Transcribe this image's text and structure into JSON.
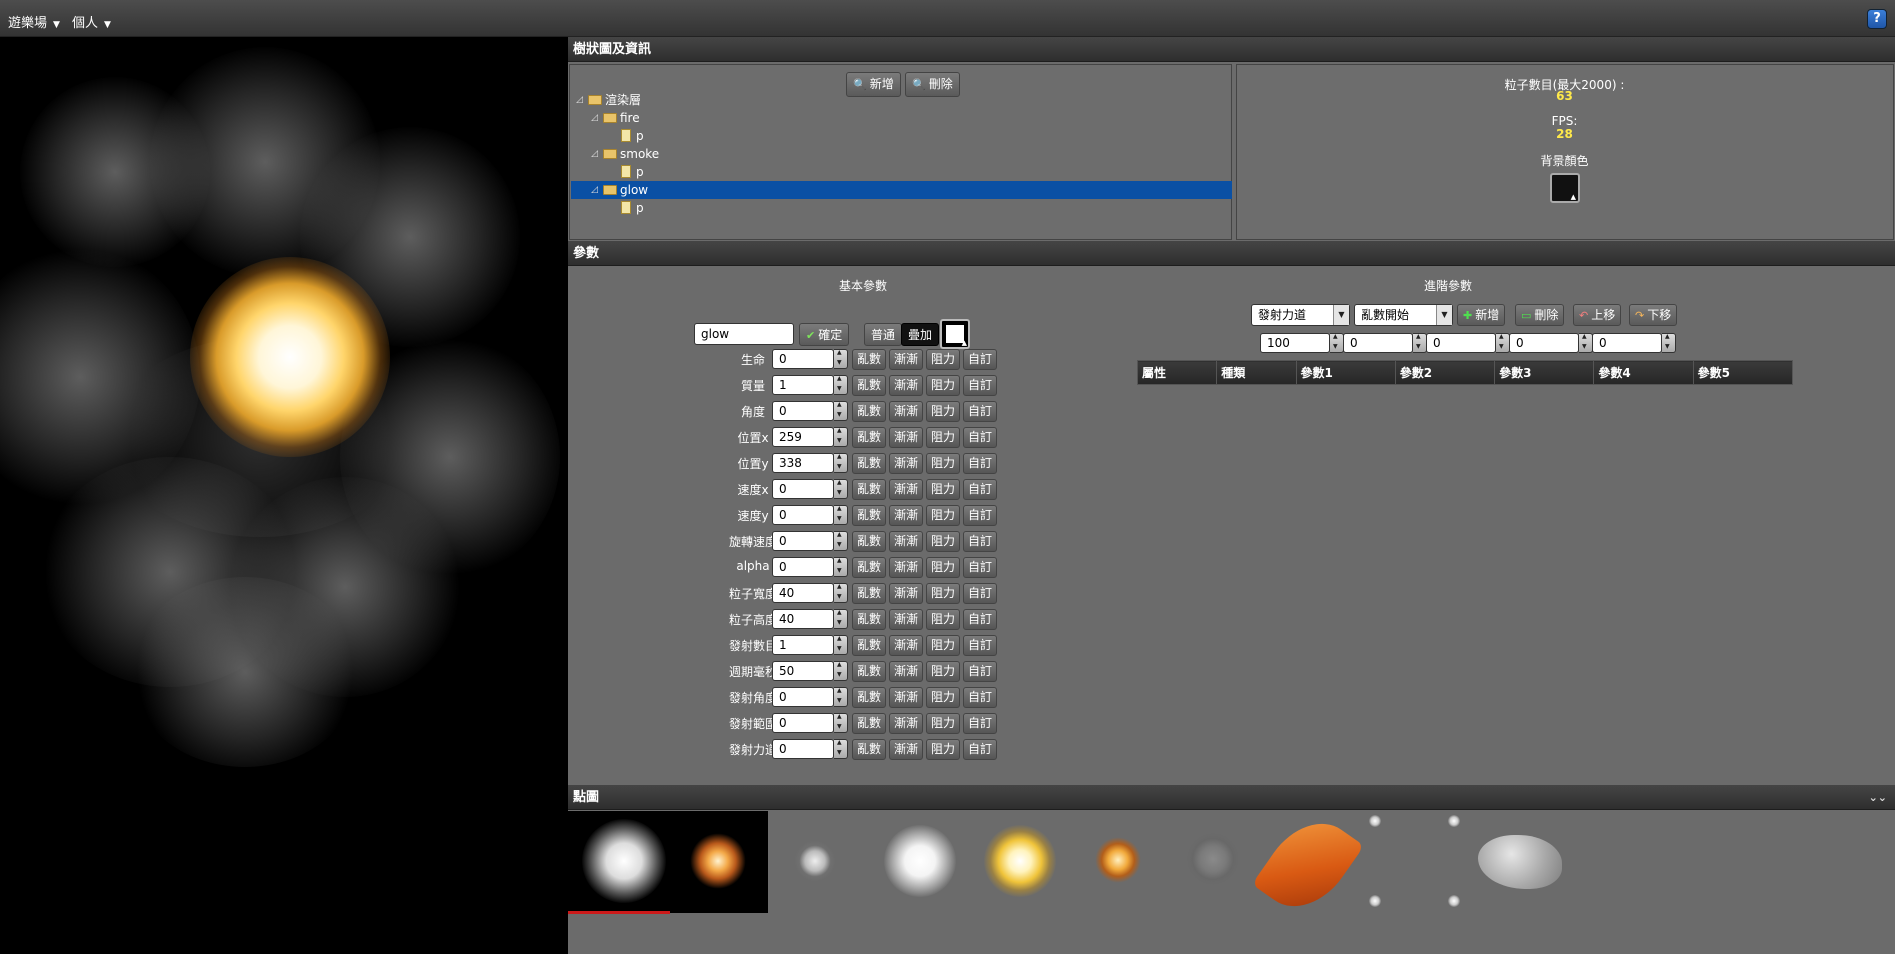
{
  "topbar": {
    "menus": [
      {
        "label": "遊樂場"
      },
      {
        "label": "個人"
      }
    ],
    "help_label": "?"
  },
  "tree_panel": {
    "title": "樹狀圖及資訊",
    "add_label": "新增",
    "delete_label": "刪除",
    "nodes": [
      {
        "label": "渲染層",
        "kind": "folder",
        "depth": 0
      },
      {
        "label": "fire",
        "kind": "folder",
        "depth": 1
      },
      {
        "label": "p",
        "kind": "doc",
        "depth": 2
      },
      {
        "label": "smoke",
        "kind": "folder",
        "depth": 1
      },
      {
        "label": "p",
        "kind": "doc",
        "depth": 2
      },
      {
        "label": "glow",
        "kind": "folder",
        "depth": 1,
        "selected": true
      },
      {
        "label": "p",
        "kind": "doc",
        "depth": 2
      }
    ]
  },
  "info": {
    "particle_count_label": "粒子數目(最大2000) :",
    "particle_count": "63",
    "fps_label": "FPS:",
    "fps": "28",
    "bg_color_label": "背景顏色",
    "bg_color": "#000000"
  },
  "params_panel": {
    "title": "參數",
    "basic_title": "基本參數",
    "name_value": "glow",
    "confirm_label": "確定",
    "normal_label": "普通",
    "additive_label": "疊加",
    "row_buttons": [
      "亂數",
      "漸漸",
      "阻力",
      "自訂"
    ],
    "rows": [
      {
        "label": "生命",
        "value": "0"
      },
      {
        "label": "質量",
        "value": "1"
      },
      {
        "label": "角度",
        "value": "0"
      },
      {
        "label": "位置x",
        "value": "259"
      },
      {
        "label": "位置y",
        "value": "338"
      },
      {
        "label": "速度x",
        "value": "0"
      },
      {
        "label": "速度y",
        "value": "0"
      },
      {
        "label": "旋轉速度",
        "value": "0"
      },
      {
        "label": "alpha",
        "value": "0"
      },
      {
        "label": "粒子寬度",
        "value": "40"
      },
      {
        "label": "粒子高度",
        "value": "40"
      },
      {
        "label": "發射數目",
        "value": "1"
      },
      {
        "label": "週期毫秒",
        "value": "50"
      },
      {
        "label": "發射角度",
        "value": "0"
      },
      {
        "label": "發射範圍",
        "value": "0"
      },
      {
        "label": "發射力道",
        "value": "0"
      }
    ],
    "advanced": {
      "title": "進階參數",
      "select1": "發射力道",
      "select2": "亂數開始",
      "add_label": "新增",
      "delete_label": "刪除",
      "up_label": "上移",
      "down_label": "下移",
      "inputs": [
        "100",
        "0",
        "0",
        "0",
        "0"
      ],
      "columns": [
        "屬性",
        "種類",
        "參數1",
        "參數2",
        "參數3",
        "參數4",
        "參數5"
      ]
    }
  },
  "textures_panel": {
    "title": "點圖",
    "collapse_icon": "double-chevron-icon",
    "items": [
      "white-soft-dot",
      "fire-burst",
      "smoke-puff",
      "white-glow",
      "yellow-glow",
      "small-fire",
      "dark-smoke",
      "orange-leaf",
      "white-sparkles",
      "grey-rock"
    ],
    "selected_index": 0,
    "selection_color": "#cc1a1a"
  }
}
